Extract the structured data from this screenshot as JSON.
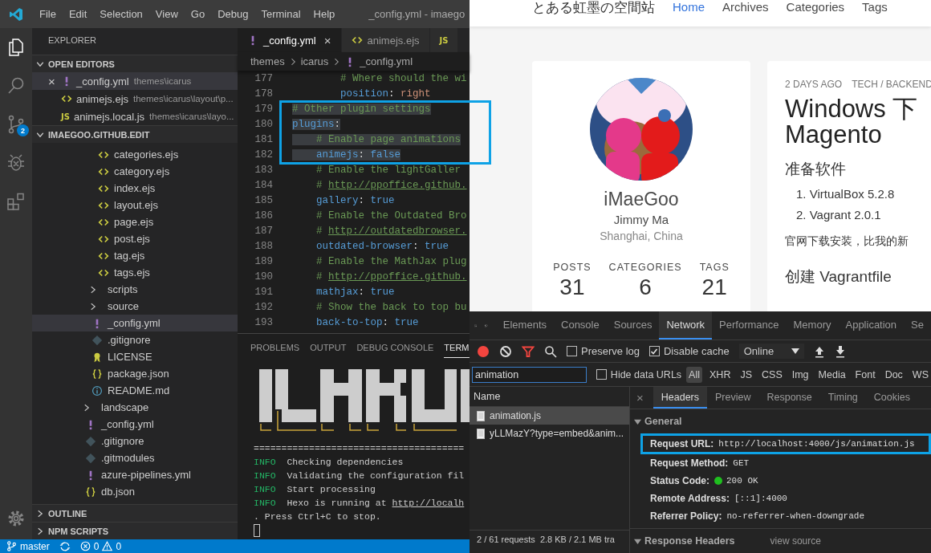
{
  "menu": {
    "items": [
      "File",
      "Edit",
      "Selection",
      "View",
      "Go",
      "Debug",
      "Terminal",
      "Help"
    ],
    "title": "_config.yml - imaego"
  },
  "activity_bar": {
    "items": [
      {
        "kind": "files",
        "selected": true
      },
      {
        "kind": "search",
        "selected": false
      },
      {
        "kind": "scm",
        "selected": false,
        "badge": "2"
      },
      {
        "kind": "debug",
        "selected": false
      },
      {
        "kind": "extensions",
        "selected": false
      }
    ]
  },
  "explorer": {
    "title": "EXPLORER",
    "sections": [
      {
        "title": "OPEN EDITORS",
        "expanded": true,
        "kind": "editors",
        "items": [
          {
            "name": "_config.yml",
            "path": "themes\\icarus",
            "kind": "yml",
            "selected": true,
            "close": "×"
          },
          {
            "name": "animejs.ejs",
            "path": "themes\\icarus\\layout\\p...",
            "kind": "ejs",
            "selected": false
          },
          {
            "name": "animejs.local.js",
            "path": "themes\\icarus\\layo...",
            "kind": "js",
            "icon_label": "JS",
            "selected": false
          }
        ]
      },
      {
        "title": "IMAEGOO.GITHUB.EDIT",
        "expanded": true,
        "kind": "tree",
        "tree": [
          {
            "children": [
              {
                "children": [
                  {
                    "name": "categories.ejs",
                    "kind": "ejs",
                    "selected": false
                  },
                  {
                    "name": "category.ejs",
                    "kind": "ejs",
                    "selected": false
                  },
                  {
                    "name": "index.ejs",
                    "kind": "ejs",
                    "selected": false
                  },
                  {
                    "name": "layout.ejs",
                    "kind": "ejs",
                    "selected": false
                  },
                  {
                    "name": "page.ejs",
                    "kind": "ejs",
                    "selected": false
                  },
                  {
                    "name": "post.ejs",
                    "kind": "ejs",
                    "selected": false
                  },
                  {
                    "name": "tag.ejs",
                    "kind": "ejs",
                    "selected": false
                  },
                  {
                    "name": "tags.ejs",
                    "kind": "ejs",
                    "selected": false
                  }
                ]
              },
              {
                "name": "scripts",
                "kind": "folder",
                "expanded": false,
                "selected": false
              },
              {
                "name": "source",
                "kind": "folder",
                "expanded": false,
                "selected": false
              },
              {
                "name": "_config.yml",
                "kind": "yml",
                "selected": true
              },
              {
                "name": ".gitignore",
                "kind": "git",
                "selected": false
              },
              {
                "name": "LICENSE",
                "kind": "license",
                "selected": false
              },
              {
                "name": "package.json",
                "kind": "json",
                "selected": false
              },
              {
                "name": "README.md",
                "kind": "info",
                "selected": false
              }
            ]
          },
          {
            "name": "landscape",
            "kind": "folder",
            "expanded": false,
            "selected": false
          },
          {
            "name": "_config.yml",
            "kind": "yml",
            "selected": false
          },
          {
            "name": ".gitignore",
            "kind": "git",
            "selected": false
          },
          {
            "name": ".gitmodules",
            "kind": "git",
            "selected": false
          },
          {
            "name": "azure-pipelines.yml",
            "kind": "yml",
            "selected": false
          },
          {
            "name": "db.json",
            "kind": "json",
            "selected": false
          }
        ]
      },
      {
        "title": "OUTLINE",
        "expanded": false,
        "kind": "collapsed"
      },
      {
        "title": "NPM SCRIPTS",
        "expanded": false,
        "kind": "collapsed"
      }
    ]
  },
  "editor": {
    "tabs": [
      {
        "label": "_config.yml",
        "kind": "yml",
        "selected": true,
        "close": "×"
      },
      {
        "label": "animejs.ejs",
        "kind": "ejs",
        "selected": false
      },
      {
        "kind": "js",
        "icon_label": "JS",
        "selected": false
      }
    ],
    "breadcrumb": [
      {
        "label": "themes"
      },
      {
        "label": "icarus"
      },
      {
        "label": "_config.yml",
        "kind": "yml"
      }
    ],
    "blocks": [
      {
        "framed": false,
        "lines": [
          {
            "n": "177",
            "kind": "comment",
            "text": "        # Where should the wi",
            "selected": false
          },
          {
            "n": "178",
            "kind": "pair",
            "key": "        position",
            "sep": ": ",
            "value": {
              "text": "right",
              "kind": "string"
            },
            "selected": false
          }
        ]
      },
      {
        "framed": true,
        "lines": [
          {
            "n": "179",
            "kind": "comment",
            "text": "# Other plugin settings",
            "selected": true
          },
          {
            "n": "180",
            "kind": "pair",
            "key": "plugins",
            "sep": ":",
            "selected": true
          },
          {
            "n": "181",
            "kind": "comment",
            "text": "    # Enable page animations",
            "selected": true
          },
          {
            "n": "182",
            "kind": "pair",
            "key": "    animejs",
            "sep": ": ",
            "value": {
              "text": "false",
              "kind": "bool"
            },
            "selected": true
          }
        ]
      },
      {
        "framed": false,
        "lines": [
          {
            "n": "183",
            "kind": "comment",
            "text": "    # Enable the lightGaller",
            "selected": false
          },
          {
            "n": "184",
            "kind": "comment",
            "text": "    # ",
            "link": "http://ppoffice.github.",
            "selected": false
          },
          {
            "n": "185",
            "kind": "pair",
            "key": "    gallery",
            "sep": ": ",
            "value": {
              "text": "true",
              "kind": "bool"
            },
            "selected": false
          },
          {
            "n": "186",
            "kind": "comment",
            "text": "    # Enable the Outdated Bro",
            "selected": false
          },
          {
            "n": "187",
            "kind": "comment",
            "text": "    # ",
            "link": "http://outdatedbrowser.",
            "selected": false
          },
          {
            "n": "188",
            "kind": "pair",
            "key": "    outdated-browser",
            "sep": ": ",
            "value": {
              "text": "true",
              "kind": "bool"
            },
            "selected": false
          },
          {
            "n": "189",
            "kind": "comment",
            "text": "    # Enable the MathJax plug",
            "selected": false
          },
          {
            "n": "190",
            "kind": "comment",
            "text": "    # ",
            "link": "http://ppoffice.github.",
            "selected": false
          },
          {
            "n": "191",
            "kind": "pair",
            "key": "    mathjax",
            "sep": ": ",
            "value": {
              "text": "true",
              "kind": "bool"
            },
            "selected": false
          },
          {
            "n": "192",
            "kind": "comment",
            "text": "    # Show the back to top bu",
            "selected": false
          },
          {
            "n": "193",
            "kind": "pair",
            "key": "    back-to-top",
            "sep": ": ",
            "value": {
              "text": "true",
              "kind": "bool"
            },
            "selected": false
          }
        ]
      }
    ]
  },
  "panel": {
    "tabs": [
      {
        "label": "PROBLEMS",
        "selected": false
      },
      {
        "label": "OUTPUT",
        "selected": false
      },
      {
        "label": "DEBUG CONSOLE",
        "selected": false
      },
      {
        "label": "TERM",
        "selected": true
      }
    ],
    "terminal": {
      "rule": "======================================",
      "lines": [
        {
          "level": "INFO",
          "text": "  Checking dependencies"
        },
        {
          "level": "INFO",
          "text": "  Validating the configuration fil"
        },
        {
          "level": "INFO",
          "text": "  Start processing"
        },
        {
          "level": "INFO",
          "text": "  Hexo is running at ",
          "link": "http://localh"
        }
      ],
      "tail": ". Press Ctrl+C to stop.",
      "cursor": true
    }
  },
  "status_bar": {
    "branch": "master",
    "errors": "0",
    "warnings": "0"
  },
  "website": {
    "logo": "とある虹墨の空間站",
    "nav": [
      {
        "label": "Home",
        "selected": true
      },
      {
        "label": "Archives",
        "selected": false
      },
      {
        "label": "Categories",
        "selected": false
      },
      {
        "label": "Tags",
        "selected": false
      }
    ],
    "profile": {
      "name": "iMaeGoo",
      "author": "Jimmy Ma",
      "location": "Shanghai, China",
      "stats": [
        {
          "label": "POSTS",
          "value": "31"
        },
        {
          "label": "CATEGORIES",
          "value": "6"
        },
        {
          "label": "TAGS",
          "value": "21"
        }
      ]
    },
    "article": {
      "date": "2 DAYS AGO",
      "category": "TECH / BACKEND",
      "title_lines": [
        "Windows 下",
        "Magento"
      ],
      "blocks": [
        {
          "kind": "h3",
          "text": "准备软件"
        },
        {
          "kind": "li",
          "text": "1. VirtualBox 5.2.8"
        },
        {
          "kind": "li",
          "text": "2. Vagrant 2.0.1"
        },
        {
          "kind": "p",
          "text": "官网下载安装，比我的新"
        },
        {
          "kind": "h3",
          "text": "创建 Vagrantfile"
        }
      ]
    }
  },
  "devtools": {
    "tabs": [
      {
        "label": "Elements",
        "selected": false
      },
      {
        "label": "Console",
        "selected": false
      },
      {
        "label": "Sources",
        "selected": false
      },
      {
        "label": "Network",
        "selected": true
      },
      {
        "label": "Performance",
        "selected": false
      },
      {
        "label": "Memory",
        "selected": false
      },
      {
        "label": "Application",
        "selected": false
      },
      {
        "label": "Se",
        "selected": false
      }
    ],
    "toolbar": {
      "recording": true,
      "filter_active": true,
      "preserve_log": {
        "label": "Preserve log",
        "checked": false
      },
      "disable_cache": {
        "label": "Disable cache",
        "checked": true
      },
      "throttle": "Online"
    },
    "filter": {
      "value": "animation",
      "hide_data_urls": {
        "label": "Hide data URLs",
        "checked": false
      },
      "types": [
        {
          "label": "All",
          "selected": true
        },
        {
          "label": "XHR",
          "selected": false
        },
        {
          "label": "JS",
          "selected": false
        },
        {
          "label": "CSS",
          "selected": false
        },
        {
          "label": "Img",
          "selected": false
        },
        {
          "label": "Media",
          "selected": false
        },
        {
          "label": "Font",
          "selected": false
        },
        {
          "label": "Doc",
          "selected": false
        },
        {
          "label": "WS",
          "selected": false
        }
      ]
    },
    "requests": {
      "header": "Name",
      "rows": [
        {
          "name": "animation.js",
          "selected": true
        },
        {
          "name": "yLLMazY?type=embed&anim...",
          "selected": false
        }
      ],
      "summary": "2 / 61 requests  2.8 KB / 2.1 MB tra"
    },
    "details": {
      "close": "×",
      "tabs": [
        {
          "label": "Headers",
          "selected": true
        },
        {
          "label": "Preview",
          "selected": false
        },
        {
          "label": "Response",
          "selected": false
        },
        {
          "label": "Timing",
          "selected": false
        },
        {
          "label": "Cookies",
          "selected": false
        }
      ],
      "sections": [
        {
          "title": "General",
          "expanded": true,
          "rows": [
            {
              "key": "Request URL:",
              "value": "http://localhost:4000/js/animation.js",
              "framed": true
            },
            {
              "key": "Request Method:",
              "value": "GET",
              "framed": false
            },
            {
              "key": "Status Code:",
              "value": "200 OK",
              "color": "#1fbf1f",
              "framed": false
            },
            {
              "key": "Remote Address:",
              "value": "[::1]:4000",
              "framed": false
            },
            {
              "key": "Referrer Policy:",
              "value": "no-referrer-when-downgrade",
              "framed": false
            }
          ]
        },
        {
          "title": "Response Headers",
          "expanded": true,
          "link": "view source"
        }
      ]
    }
  }
}
